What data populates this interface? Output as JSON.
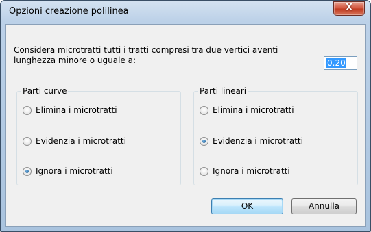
{
  "window": {
    "title": "Opzioni creazione polilinea",
    "close_glyph": "X"
  },
  "prompt": {
    "text": "Considera microtratti tutti i tratti compresi tra due vertici aventi lunghezza minore o uguale a:"
  },
  "threshold": {
    "value": "0.20"
  },
  "groups": {
    "curve": {
      "title": "Parti curve",
      "options": [
        {
          "label": "Elimina i microtratti",
          "checked": false
        },
        {
          "label": "Evidenzia i microtratti",
          "checked": false
        },
        {
          "label": "Ignora i microtratti",
          "checked": true
        }
      ]
    },
    "linear": {
      "title": "Parti lineari",
      "options": [
        {
          "label": "Elimina i microtratti",
          "checked": false
        },
        {
          "label": "Evidenzia i microtratti",
          "checked": true
        },
        {
          "label": "Ignora i microtratti",
          "checked": false
        }
      ]
    }
  },
  "buttons": {
    "ok": "OK",
    "cancel": "Annulla"
  }
}
